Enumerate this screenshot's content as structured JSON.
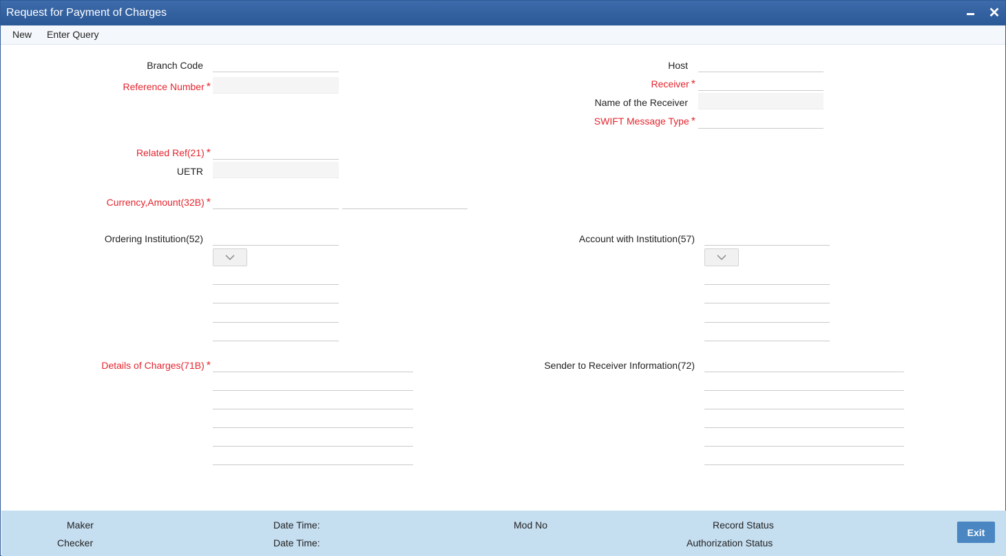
{
  "window": {
    "title": "Request for Payment of Charges",
    "minimize_icon": "minimize-icon",
    "close_icon": "close-icon",
    "close_glyph": "✕"
  },
  "menu": {
    "new_label": "New",
    "enter_query_label": "Enter Query"
  },
  "form": {
    "branch_code": {
      "label": "Branch Code",
      "value": ""
    },
    "reference_number": {
      "label": "Reference Number",
      "value": "",
      "required": true
    },
    "host": {
      "label": "Host",
      "value": ""
    },
    "receiver": {
      "label": "Receiver",
      "value": "",
      "required": true
    },
    "receiver_name": {
      "label": "Name of the Receiver",
      "value": ""
    },
    "swift_message_type": {
      "label": "SWIFT Message Type",
      "value": "",
      "required": true
    },
    "related_ref": {
      "label": "Related Ref(21)",
      "value": "",
      "required": true
    },
    "uetr": {
      "label": "UETR",
      "value": ""
    },
    "currency_amount": {
      "label": "Currency,Amount(32B)",
      "currency": "",
      "amount": "",
      "required": true
    },
    "ordering_institution": {
      "label": "Ordering Institution(52)",
      "value": "",
      "option": "",
      "lines": [
        "",
        "",
        "",
        ""
      ]
    },
    "account_with_institution": {
      "label": "Account with Institution(57)",
      "value": "",
      "option": "",
      "lines": [
        "",
        "",
        "",
        ""
      ]
    },
    "details_of_charges": {
      "label": "Details of Charges(71B)",
      "required": true,
      "lines": [
        "",
        "",
        "",
        "",
        "",
        ""
      ]
    },
    "sender_to_receiver": {
      "label": "Sender to Receiver Information(72)",
      "lines": [
        "",
        "",
        "",
        "",
        "",
        ""
      ]
    },
    "required_marker": "*"
  },
  "footer": {
    "maker_label": "Maker",
    "checker_label": "Checker",
    "date_time_label": "Date Time:",
    "mod_no_label": "Mod No",
    "record_status_label": "Record Status",
    "authorization_status_label": "Authorization Status",
    "exit_label": "Exit"
  },
  "colors": {
    "titlebar": "#2b5896",
    "required_label": "#e4252e",
    "footer_bg": "#c5def0",
    "exit_button": "#4a87c2"
  }
}
